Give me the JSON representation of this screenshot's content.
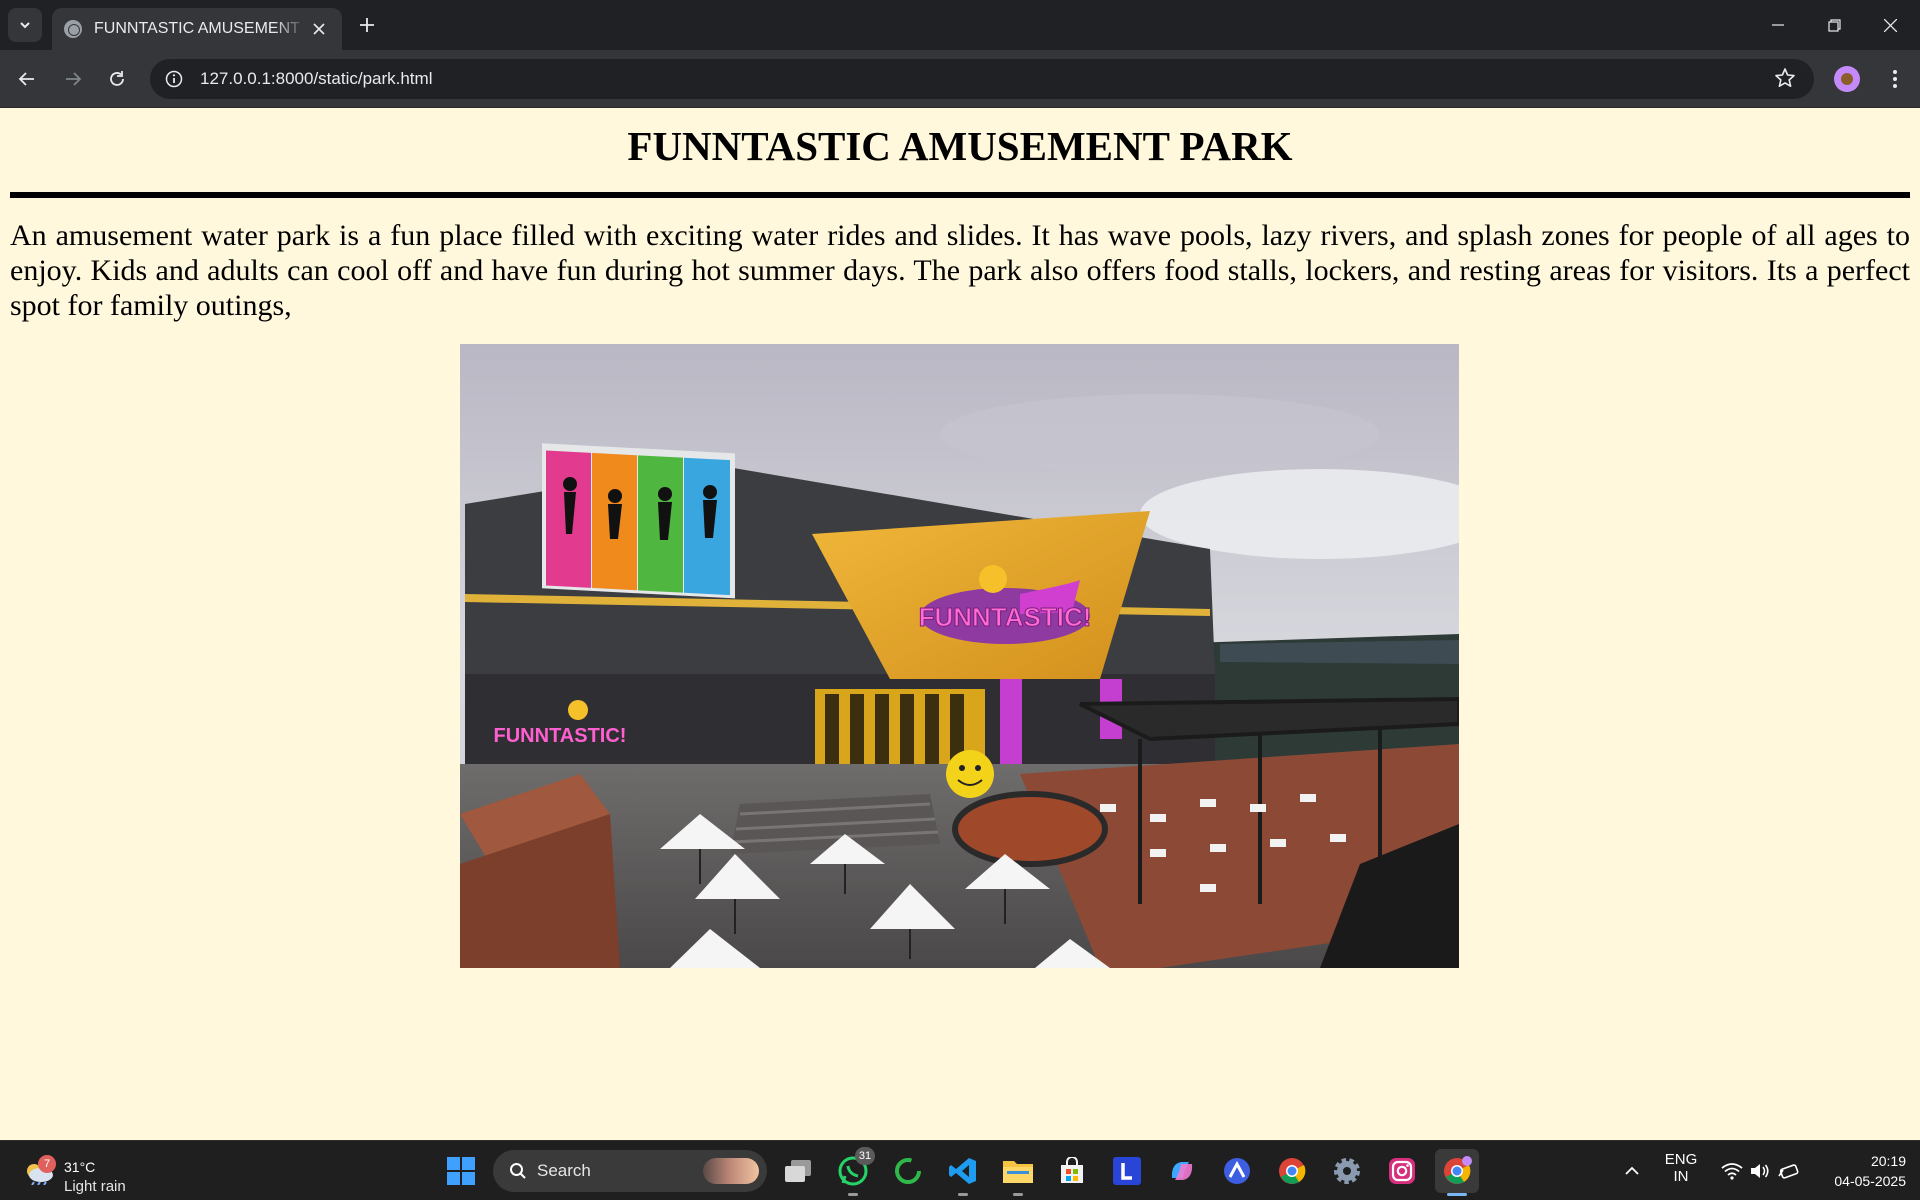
{
  "browser": {
    "tab": {
      "title": "FUNNTASTIC AMUSEMENT PARK"
    },
    "address_bar": {
      "url": "127.0.0.1:8000/static/park.html"
    },
    "icons": {
      "tab_search": "chevron-down-icon",
      "new_tab": "plus-icon",
      "back": "arrow-left-icon",
      "forward": "arrow-right-icon",
      "reload": "reload-icon",
      "site_info": "info-icon",
      "bookmark": "star-icon",
      "menu": "kebab-menu-icon"
    },
    "window_controls": [
      "minimize",
      "restore",
      "close"
    ]
  },
  "page": {
    "title": "FUNNTASTIC AMUSEMENT PARK",
    "description": "An amusement water park is a fun place filled with exciting water rides and slides. It has wave pools, lazy rivers, and splash zones for people of all ages to enjoy. Kids and adults can cool off and have fun during hot summer days. The park also offers food stalls, lockers, and resting areas for visitors. Its a perfect spot for family outings,",
    "image": {
      "signs": [
        "FUNNTASTIC!",
        "FUNNTASTIC!"
      ]
    },
    "colors": {
      "background": "#fff8dc",
      "text": "#000000"
    }
  },
  "taskbar": {
    "weather": {
      "badge": "7",
      "temperature": "31°C",
      "condition": "Light rain"
    },
    "search": {
      "placeholder": "Search"
    },
    "pinned": [
      {
        "name": "start",
        "icon": "windows-logo-icon"
      },
      {
        "name": "task-view",
        "icon": "task-view-icon"
      },
      {
        "name": "whatsapp",
        "icon": "whatsapp-icon",
        "badge": "31"
      },
      {
        "name": "app-ring",
        "icon": "green-ring-icon"
      },
      {
        "name": "vscode",
        "icon": "vscode-icon"
      },
      {
        "name": "file-explorer",
        "icon": "folder-icon"
      },
      {
        "name": "microsoft-store",
        "icon": "store-icon"
      },
      {
        "name": "l-app",
        "icon": "l-app-icon"
      },
      {
        "name": "copilot",
        "icon": "copilot-icon"
      },
      {
        "name": "arc-app",
        "icon": "triangle-app-icon"
      },
      {
        "name": "chrome",
        "icon": "chrome-icon"
      },
      {
        "name": "settings",
        "icon": "gear-icon"
      },
      {
        "name": "instagram",
        "icon": "instagram-icon"
      },
      {
        "name": "chrome-profile",
        "icon": "chrome-profile-icon"
      }
    ],
    "tray": {
      "language": "ENG",
      "region": "IN"
    },
    "clock": {
      "time": "20:19",
      "date": "04-05-2025"
    }
  }
}
